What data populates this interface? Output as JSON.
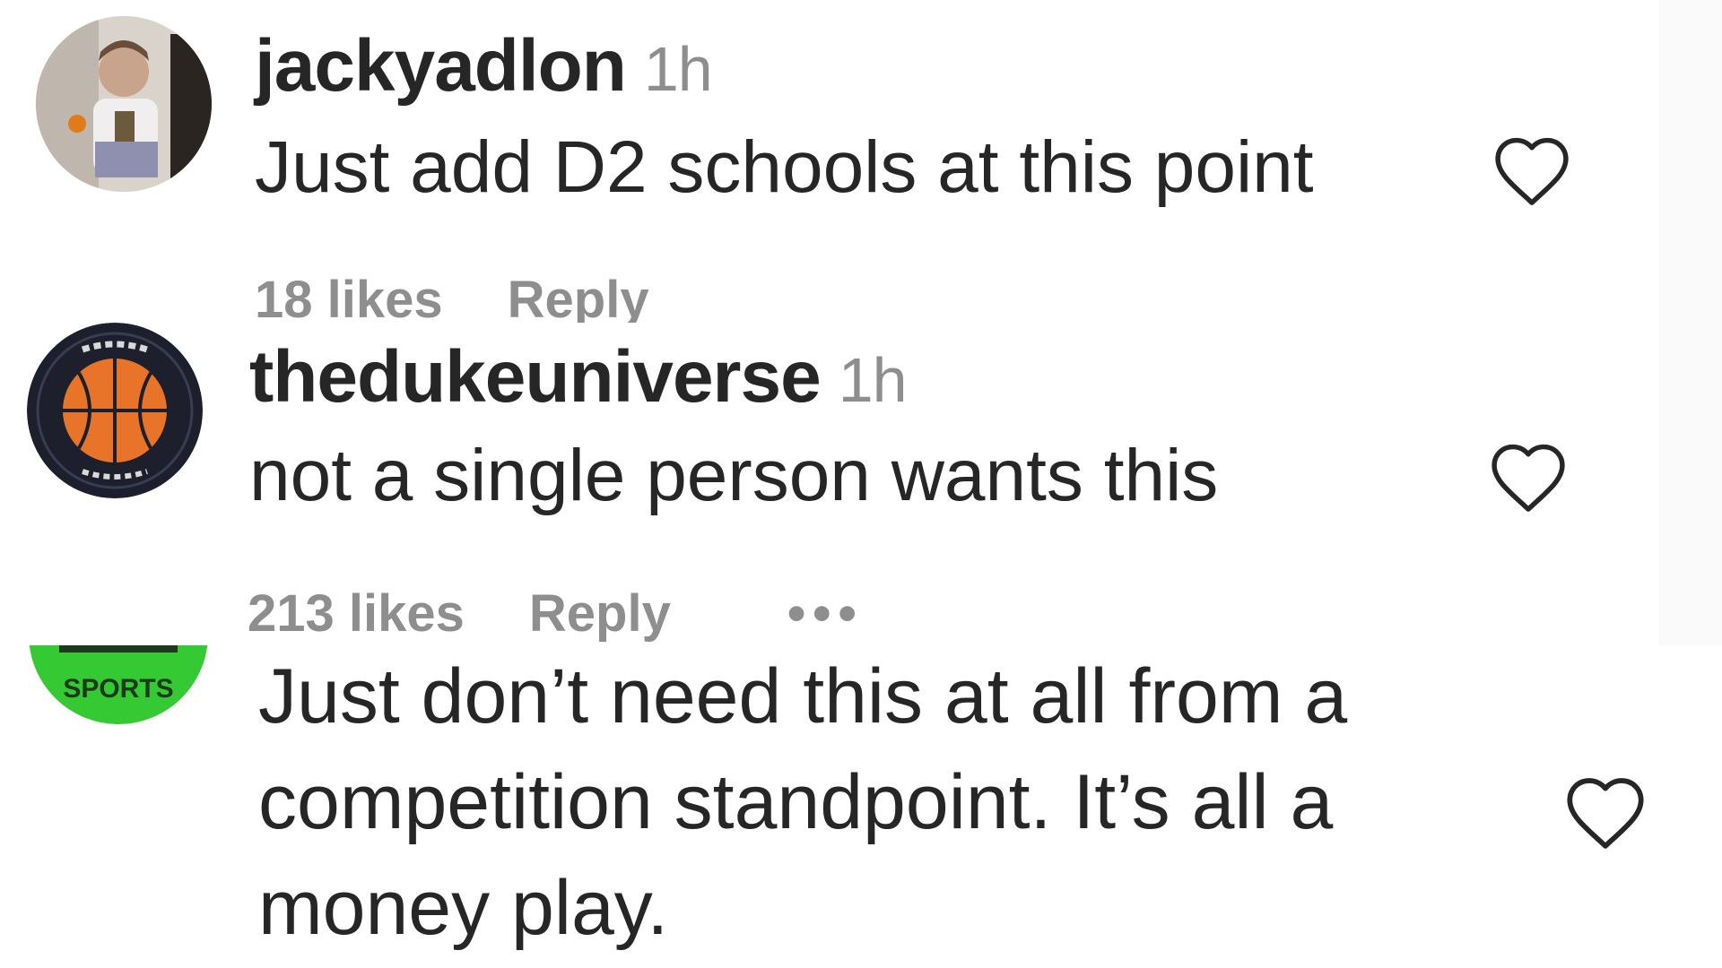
{
  "comments": [
    {
      "username": "jackyadlon",
      "time": "1h",
      "text": "Just add D2 schools at this point",
      "likes": "18 likes",
      "reply": "Reply",
      "avatar_icon": "user-photo-icon",
      "like_icon": "heart-outline-icon"
    },
    {
      "username": "thedukeuniverse",
      "time": "1h",
      "text": "not a single person wants this",
      "likes": "213 likes",
      "reply": "Reply",
      "more": "•••",
      "avatar_icon": "basketball-logo-icon",
      "like_icon": "heart-outline-icon"
    },
    {
      "text_lines": [
        "Just don’t need this at all from a",
        "competition standpoint. It’s all a",
        "money play."
      ],
      "avatar_label": "SPORTS",
      "avatar_icon": "green-sports-logo-icon",
      "like_icon": "heart-outline-icon"
    }
  ],
  "colors": {
    "text": "#262626",
    "secondary": "#8e8e8e",
    "background": "#ffffff",
    "sports_green": "#35c934"
  }
}
